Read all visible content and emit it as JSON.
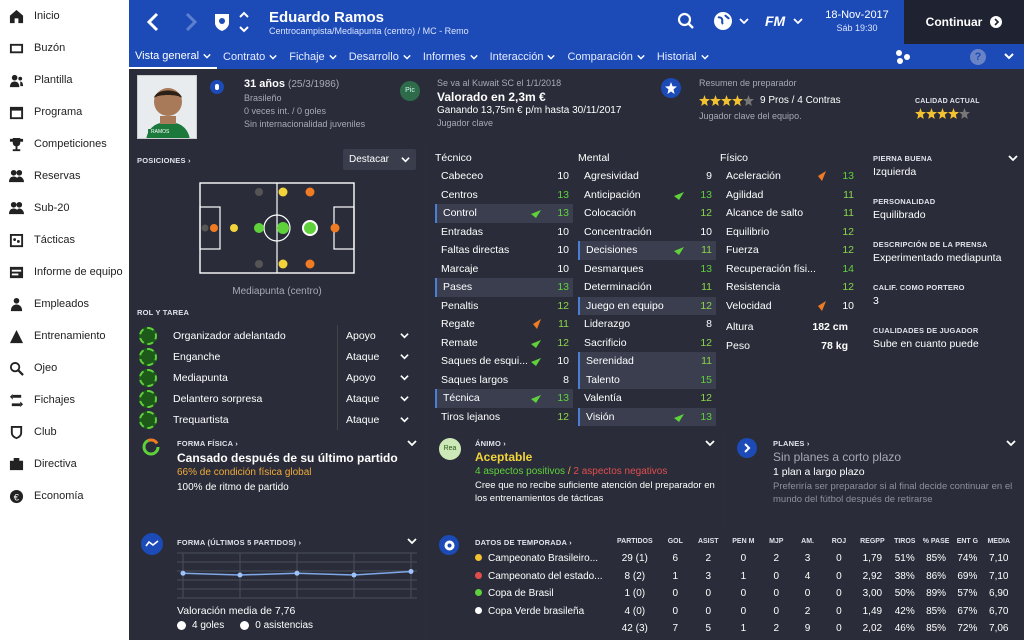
{
  "sidebar": {
    "items": [
      {
        "label": "Inicio",
        "icon": "home-icon"
      },
      {
        "label": "Buzón",
        "icon": "inbox-icon"
      },
      {
        "label": "Plantilla",
        "icon": "squad-icon"
      },
      {
        "label": "Programa",
        "icon": "calendar-icon"
      },
      {
        "label": "Competiciones",
        "icon": "trophy-icon"
      },
      {
        "label": "Reservas",
        "icon": "reserves-icon"
      },
      {
        "label": "Sub-20",
        "icon": "u20-icon"
      },
      {
        "label": "Tácticas",
        "icon": "tactics-icon"
      },
      {
        "label": "Informe de equipo",
        "icon": "team-report-icon"
      },
      {
        "label": "Empleados",
        "icon": "staff-icon"
      },
      {
        "label": "Entrenamiento",
        "icon": "training-icon"
      },
      {
        "label": "Ojeo",
        "icon": "search-icon"
      },
      {
        "label": "Fichajes",
        "icon": "transfers-icon"
      },
      {
        "label": "Club",
        "icon": "club-icon"
      },
      {
        "label": "Directiva",
        "icon": "board-icon"
      },
      {
        "label": "Economía",
        "icon": "finance-icon"
      }
    ]
  },
  "topbar": {
    "player_name": "Eduardo Ramos",
    "position": "Centrocampista/Mediapunta (centro) / MC - Remo",
    "date": "18-Nov-2017",
    "time": "Sáb 19:30",
    "fm_label": "FM",
    "continue": "Continuar"
  },
  "nav": {
    "tabs": [
      "Vista general",
      "Contrato",
      "Fichaje",
      "Desarrollo",
      "Informes",
      "Interacción",
      "Comparación",
      "Historial"
    ]
  },
  "profile": {
    "age": "31 años",
    "dob": "(25/3/1986)",
    "nationality": "Brasileño",
    "caps": "0 veces int. / 0 goles",
    "youth": "Sin internacionalidad juveniles",
    "badge_name": "RAMOS"
  },
  "contract": {
    "note": "Se va al Kuwait SC el 1/1/2018",
    "value": "Valorado en 2,3m €",
    "wage": "Ganando 13,75m € p/m hasta 30/11/2017",
    "role": "Jugador clave",
    "badge": "Pic"
  },
  "coach": {
    "title": "Resumen de preparador",
    "pros": "9 Pros / 4 Contras",
    "note": "Jugador clave del equipo.",
    "current_label": "CALIDAD ACTUAL",
    "pros_stars": 4,
    "current_stars": 4
  },
  "positions": {
    "label": "POSICIONES",
    "dropdown": "Destacar",
    "caption": "Mediapunta (centro)"
  },
  "roles": {
    "label": "ROL Y TAREA",
    "items": [
      {
        "role": "Organizador adelantado",
        "duty": "Apoyo"
      },
      {
        "role": "Enganche",
        "duty": "Ataque"
      },
      {
        "role": "Mediapunta",
        "duty": "Apoyo"
      },
      {
        "role": "Delantero sorpresa",
        "duty": "Ataque"
      },
      {
        "role": "Trequartista",
        "duty": "Ataque"
      }
    ]
  },
  "technical": {
    "title": "Técnico",
    "items": [
      {
        "name": "Cabeceo",
        "value": "10"
      },
      {
        "name": "Centros",
        "value": "13"
      },
      {
        "name": "Control",
        "value": "13"
      },
      {
        "name": "Entradas",
        "value": "10"
      },
      {
        "name": "Faltas directas",
        "value": "10"
      },
      {
        "name": "Marcaje",
        "value": "10"
      },
      {
        "name": "Pases",
        "value": "13"
      },
      {
        "name": "Penaltis",
        "value": "12"
      },
      {
        "name": "Regate",
        "value": "11"
      },
      {
        "name": "Remate",
        "value": "12"
      },
      {
        "name": "Saques de esqui...",
        "value": "10"
      },
      {
        "name": "Saques largos",
        "value": "8"
      },
      {
        "name": "Técnica",
        "value": "13"
      },
      {
        "name": "Tiros lejanos",
        "value": "12"
      }
    ]
  },
  "mental": {
    "title": "Mental",
    "items": [
      {
        "name": "Agresividad",
        "value": "9"
      },
      {
        "name": "Anticipación",
        "value": "13"
      },
      {
        "name": "Colocación",
        "value": "12"
      },
      {
        "name": "Concentración",
        "value": "10"
      },
      {
        "name": "Decisiones",
        "value": "11"
      },
      {
        "name": "Desmarques",
        "value": "13"
      },
      {
        "name": "Determinación",
        "value": "11"
      },
      {
        "name": "Juego en equipo",
        "value": "12"
      },
      {
        "name": "Liderazgo",
        "value": "8"
      },
      {
        "name": "Sacrificio",
        "value": "12"
      },
      {
        "name": "Serenidad",
        "value": "11"
      },
      {
        "name": "Talento",
        "value": "15"
      },
      {
        "name": "Valentía",
        "value": "12"
      },
      {
        "name": "Visión",
        "value": "13"
      }
    ]
  },
  "physical": {
    "title": "Físico",
    "items": [
      {
        "name": "Aceleración",
        "value": "13"
      },
      {
        "name": "Agilidad",
        "value": "11"
      },
      {
        "name": "Alcance de salto",
        "value": "11"
      },
      {
        "name": "Equilibrio",
        "value": "12"
      },
      {
        "name": "Fuerza",
        "value": "12"
      },
      {
        "name": "Recuperación físi...",
        "value": "14"
      },
      {
        "name": "Resistencia",
        "value": "12"
      },
      {
        "name": "Velocidad",
        "value": "10"
      }
    ],
    "height_label": "Altura",
    "height": "182 cm",
    "weight_label": "Peso",
    "weight": "78 kg"
  },
  "info": [
    {
      "label": "PIERNA BUENA",
      "value": "Izquierda"
    },
    {
      "label": "PERSONALIDAD",
      "value": "Equilibrado"
    },
    {
      "label": "DESCRIPCIÓN DE LA PRENSA",
      "value": "Experimentado mediapunta"
    },
    {
      "label": "CALIF. COMO PORTERO",
      "value": "3"
    },
    {
      "label": "CUALIDADES DE JUGADOR",
      "value": "Sube en cuanto puede"
    }
  ],
  "fitness": {
    "label": "FORMA FÍSICA",
    "title": "Cansado después de su último partido",
    "condition": "66% de condición física global",
    "rhythm": "100% de ritmo de partido"
  },
  "morale": {
    "label": "ÁNIMO",
    "title": "Aceptable",
    "positives": "4 aspectos positivos",
    "sep": "/",
    "negatives": "2 aspectos negativos",
    "note": "Cree que no recibe suficiente atención del preparador en los entrenamientos de tácticas",
    "badge": "Rea"
  },
  "plans": {
    "label": "PLANES",
    "title": "Sin planes a corto plazo",
    "sub": "1 plan a largo plazo",
    "note": "Preferiría ser preparador si al final decide continuar en el mundo del fútbol después de retirarse"
  },
  "form": {
    "label": "FORMA (ÚLTIMOS 5 PARTIDOS)",
    "avg": "Valoración media de 7,76",
    "goals": "4 goles",
    "assists": "0 asistencias"
  },
  "season": {
    "label": "DATOS DE TEMPORADA",
    "headers": [
      "PARTIDOS",
      "GOL",
      "ASIST",
      "PEN M",
      "MJP",
      "AM.",
      "ROJ",
      "REGPP",
      "TIROS",
      "% PASE",
      "ENT G",
      "MEDIA"
    ],
    "rows": [
      {
        "comp": "Campeonato Brasileiro...",
        "vals": [
          "29 (1)",
          "6",
          "2",
          "0",
          "2",
          "3",
          "0",
          "1,79",
          "51%",
          "85%",
          "74%",
          "7,10"
        ]
      },
      {
        "comp": "Campeonato del estado...",
        "vals": [
          "8 (2)",
          "1",
          "3",
          "1",
          "0",
          "4",
          "0",
          "2,92",
          "38%",
          "86%",
          "69%",
          "7,10"
        ]
      },
      {
        "comp": "Copa de Brasil",
        "vals": [
          "1 (0)",
          "0",
          "0",
          "0",
          "0",
          "0",
          "0",
          "3,00",
          "50%",
          "89%",
          "57%",
          "6,90"
        ]
      },
      {
        "comp": "Copa Verde brasileña",
        "vals": [
          "4 (0)",
          "0",
          "0",
          "0",
          "0",
          "2",
          "0",
          "1,49",
          "42%",
          "85%",
          "67%",
          "6,70"
        ]
      }
    ],
    "total": [
      "42 (3)",
      "7",
      "5",
      "1",
      "2",
      "9",
      "0",
      "2,02",
      "46%",
      "85%",
      "72%",
      "7,06"
    ]
  },
  "chart_data": {
    "type": "line",
    "title": "FORMA (ÚLTIMOS 5 PARTIDOS)",
    "values": [
      7.6,
      7.5,
      7.6,
      7.5,
      7.7
    ]
  }
}
